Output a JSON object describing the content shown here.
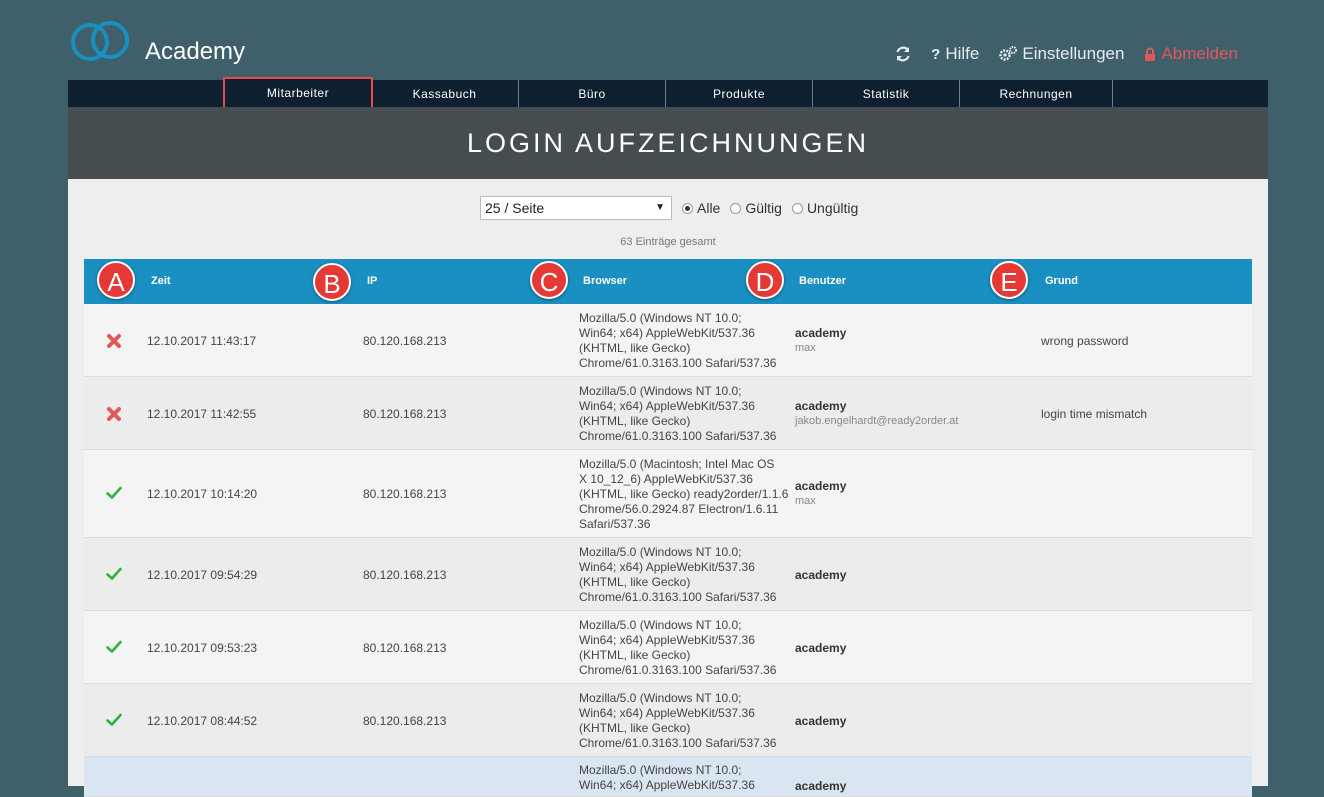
{
  "app": {
    "brand": "Academy"
  },
  "topnav": {
    "refresh_icon": "refresh-icon",
    "help": "Hilfe",
    "settings": "Einstellungen",
    "logout": "Abmelden"
  },
  "mainnav": {
    "tabs": [
      "Mitarbeiter",
      "Kassabuch",
      "Büro",
      "Produkte",
      "Statistik",
      "Rechnungen"
    ],
    "active": "Mitarbeiter"
  },
  "page": {
    "title": "LOGIN AUFZEICHNUNGEN"
  },
  "filters": {
    "per_page": "25 / Seite",
    "radio": [
      "Alle",
      "Gültig",
      "Ungültig"
    ],
    "selected": "Alle"
  },
  "total": "63 Einträge gesamt",
  "table": {
    "columns": [
      "Zeit",
      "IP",
      "Browser",
      "Benutzer",
      "Grund"
    ],
    "badges": [
      "A",
      "B",
      "C",
      "D",
      "E"
    ],
    "rows": [
      {
        "status": "invalid",
        "time": "12.10.2017 11:43:17",
        "ip": "80.120.168.213",
        "browser": [
          "Mozilla/5.0 (Windows NT 10.0;",
          "Win64; x64) AppleWebKit/537.36",
          "(KHTML, like Gecko)",
          "Chrome/61.0.3163.100 Safari/537.36"
        ],
        "user": "academy",
        "user_sub": "max",
        "reason": "wrong password"
      },
      {
        "status": "invalid",
        "time": "12.10.2017 11:42:55",
        "ip": "80.120.168.213",
        "browser": [
          "Mozilla/5.0 (Windows NT 10.0;",
          "Win64; x64) AppleWebKit/537.36",
          "(KHTML, like Gecko)",
          "Chrome/61.0.3163.100 Safari/537.36"
        ],
        "user": "academy",
        "user_sub": "jakob.engelhardt@ready2order.at",
        "reason": "login time mismatch"
      },
      {
        "status": "valid",
        "time": "12.10.2017 10:14:20",
        "ip": "80.120.168.213",
        "browser": [
          "Mozilla/5.0 (Macintosh; Intel Mac OS",
          "X 10_12_6) AppleWebKit/537.36",
          "(KHTML, like Gecko) ready2order/1.1.6",
          "Chrome/56.0.2924.87 Electron/1.6.11",
          "Safari/537.36"
        ],
        "user": "academy",
        "user_sub": "max",
        "reason": ""
      },
      {
        "status": "valid",
        "time": "12.10.2017 09:54:29",
        "ip": "80.120.168.213",
        "browser": [
          "Mozilla/5.0 (Windows NT 10.0;",
          "Win64; x64) AppleWebKit/537.36",
          "(KHTML, like Gecko)",
          "Chrome/61.0.3163.100 Safari/537.36"
        ],
        "user": "academy",
        "user_sub": "",
        "reason": ""
      },
      {
        "status": "valid",
        "time": "12.10.2017 09:53:23",
        "ip": "80.120.168.213",
        "browser": [
          "Mozilla/5.0 (Windows NT 10.0;",
          "Win64; x64) AppleWebKit/537.36",
          "(KHTML, like Gecko)",
          "Chrome/61.0.3163.100 Safari/537.36"
        ],
        "user": "academy",
        "user_sub": "",
        "reason": ""
      },
      {
        "status": "valid",
        "time": "12.10.2017 08:44:52",
        "ip": "80.120.168.213",
        "browser": [
          "Mozilla/5.0 (Windows NT 10.0;",
          "Win64; x64) AppleWebKit/537.36",
          "(KHTML, like Gecko)",
          "Chrome/61.0.3163.100 Safari/537.36"
        ],
        "user": "academy",
        "user_sub": "",
        "reason": ""
      },
      {
        "status": "",
        "time": "",
        "ip": "",
        "browser": [
          "Mozilla/5.0 (Windows NT 10.0;",
          "Win64; x64) AppleWebKit/537.36"
        ],
        "user": "academy",
        "user_sub": "",
        "reason": ""
      }
    ]
  },
  "colors": {
    "header_blue": "#1a8fc1",
    "invalid": "#e2585a",
    "valid": "#2fb23f",
    "badge": "#e53935"
  }
}
